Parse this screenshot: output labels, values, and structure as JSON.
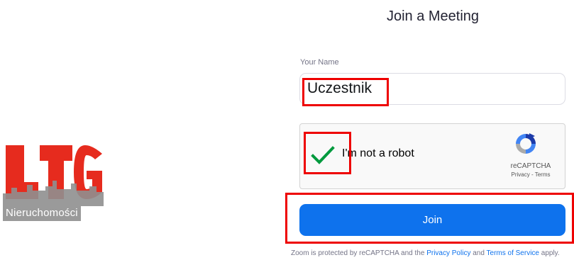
{
  "page": {
    "title": "Join a Meeting"
  },
  "logo": {
    "letters": "LTG",
    "caption": "Nieruchomości"
  },
  "form": {
    "name_label": "Your Name",
    "name_value": "Uczestnik",
    "recaptcha": {
      "checkbox_label": "I'm not a robot",
      "checked": true,
      "brand": "reCAPTCHA",
      "privacy_link": "Privacy",
      "links_separator": " - ",
      "terms_link": "Terms"
    },
    "join_button": "Join"
  },
  "footer": {
    "text_before": "Zoom is protected by reCAPTCHA and the ",
    "privacy_link": "Privacy Policy",
    "text_middle": " and ",
    "terms_link": "Terms of Service",
    "text_after": " apply."
  },
  "colors": {
    "primary_blue": "#0e72ed",
    "highlight_red": "#ee0000",
    "check_green": "#009a3e",
    "logo_red": "#e62b1e"
  }
}
